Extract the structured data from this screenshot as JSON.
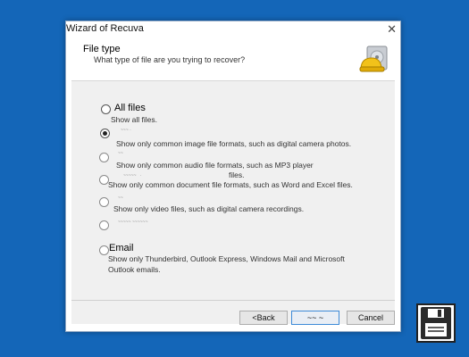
{
  "window": {
    "title": "Wizard of Recuva"
  },
  "header": {
    "title": "File type",
    "subtitle": "What type of file are you trying to recover?"
  },
  "options": [
    {
      "label": "All files",
      "description": "Show all files."
    },
    {
      "label": "",
      "description": "Show only common image file formats, such as digital camera photos."
    },
    {
      "label": "",
      "description_line1": "Show only common audio file formats, such as MP3 player",
      "description_line2": "files."
    },
    {
      "label": "",
      "description": "Show only common document file formats, such as Word and Excel files."
    },
    {
      "label": "",
      "description": "Show only video files, such as digital camera recordings."
    },
    {
      "label": ""
    },
    {
      "label": "Email",
      "description_line1": "Show only Thunderbird, Outlook Express, Windows Mail and Microsoft",
      "description_line2": "Outlook emails."
    }
  ],
  "buttons": {
    "back": "<Back",
    "next": "",
    "cancel": "Cancel"
  },
  "icons": {
    "close": "close-icon",
    "wizard": "recuva-helmet-icon",
    "save": "floppy-disk-icon"
  },
  "colors": {
    "desktop": "#1466b8",
    "panel": "#f0f0f0"
  }
}
